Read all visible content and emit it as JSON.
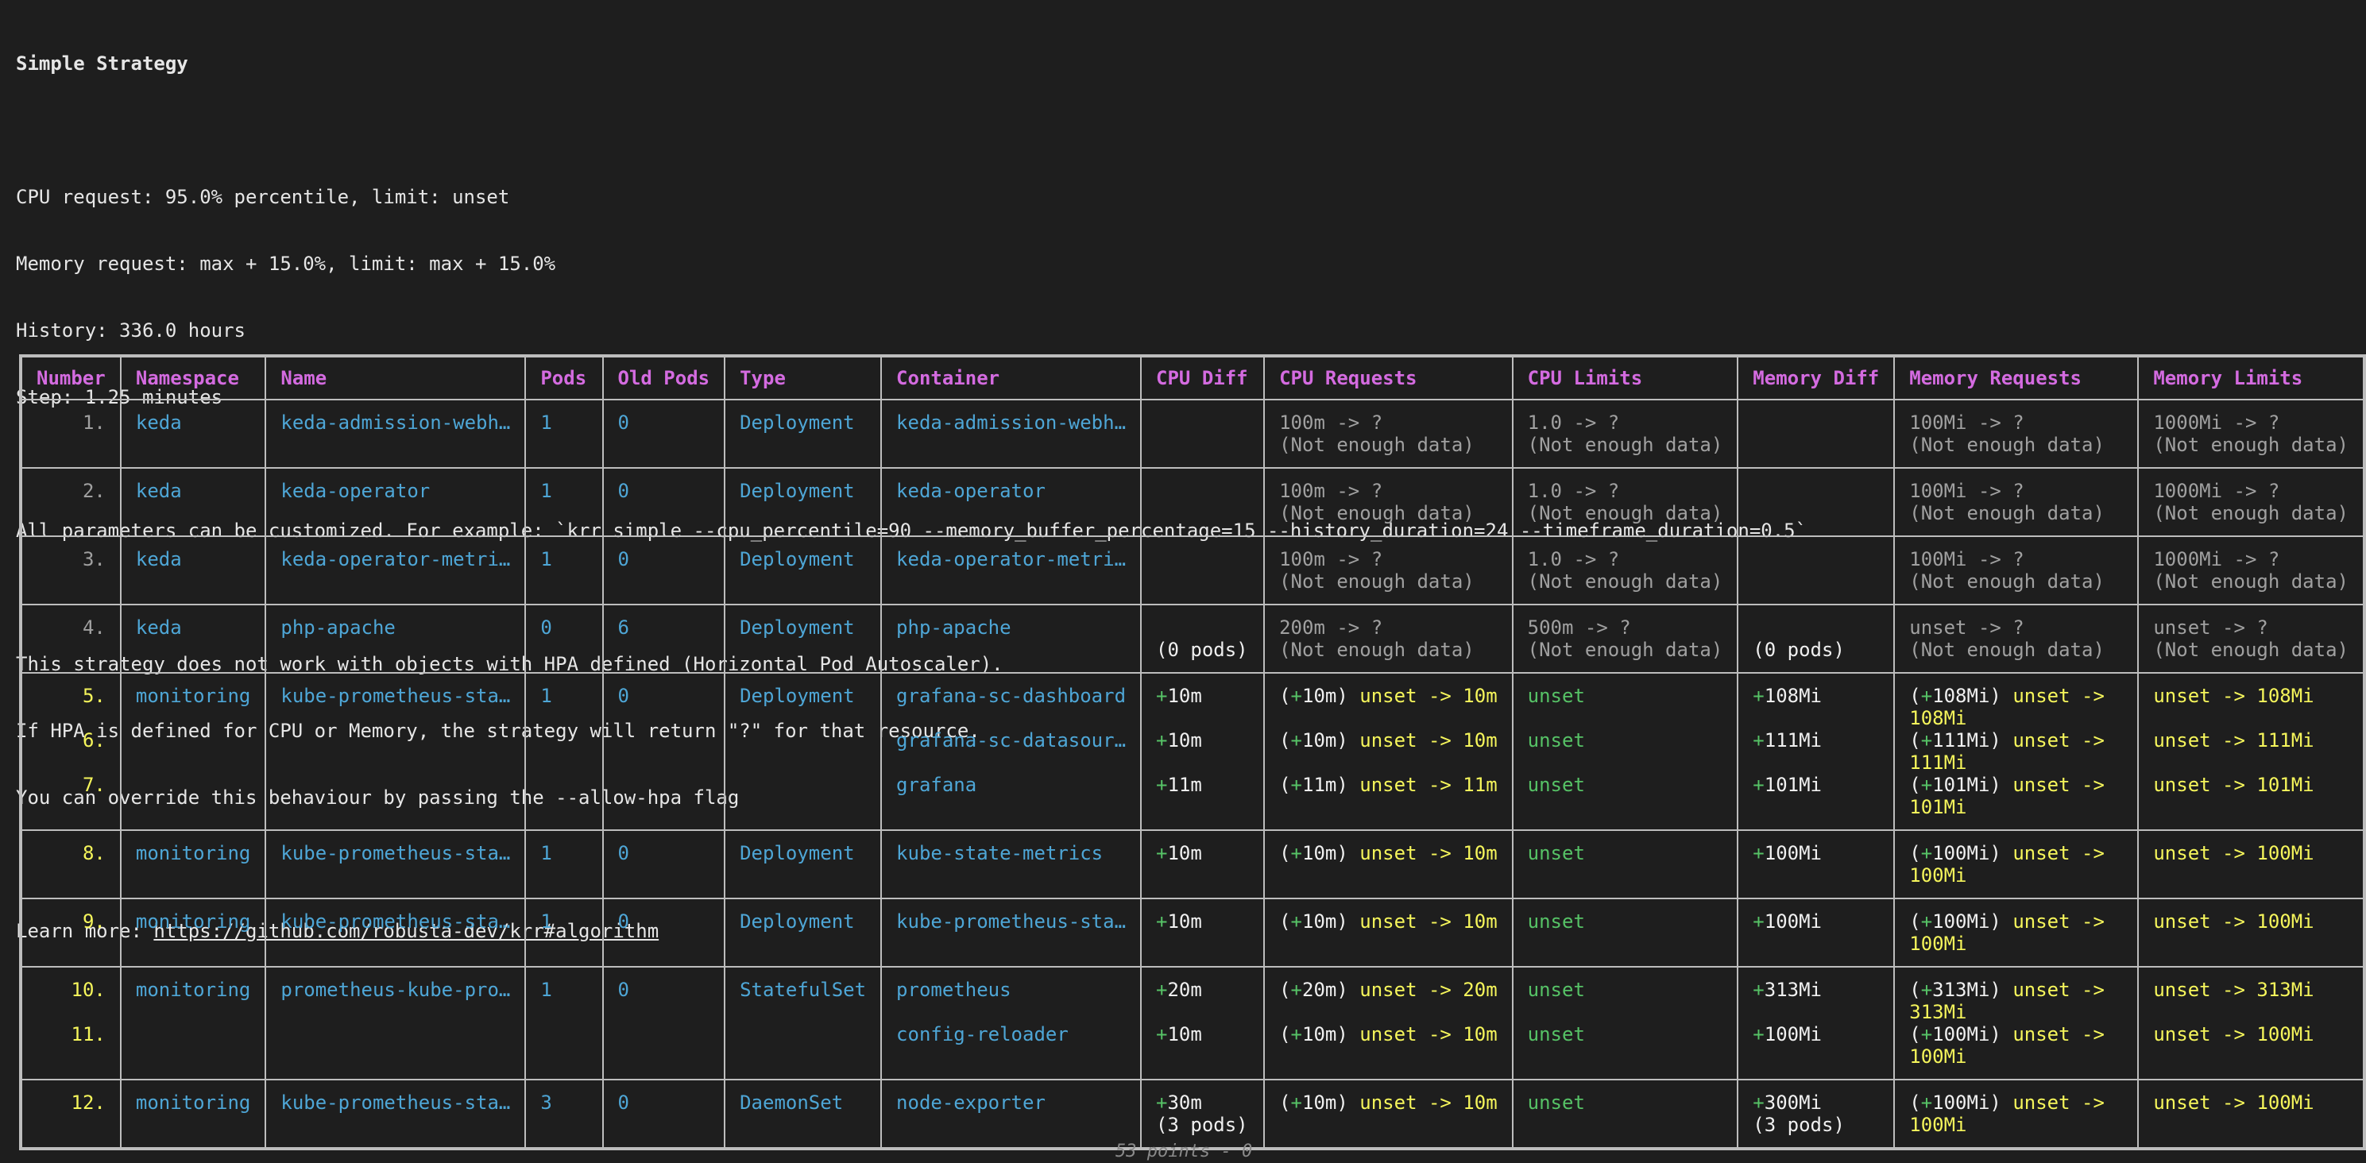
{
  "intro": {
    "title": "Simple Strategy",
    "lines1": [
      "CPU request: 95.0% percentile, limit: unset",
      "Memory request: max + 15.0%, limit: max + 15.0%",
      "History: 336.0 hours",
      "Step: 1.25 minutes"
    ],
    "customize": "All parameters can be customized. For example: `krr simple --cpu_percentile=90 --memory_buffer_percentage=15 --history_duration=24 --timeframe_duration=0.5`",
    "hpa_lines": [
      "This strategy does not work with objects with HPA defined (Horizontal Pod Autoscaler).",
      "If HPA is defined for CPU or Memory, the strategy will return \"?\" for that resource.",
      "You can override this behaviour by passing the --allow-hpa flag"
    ],
    "learn_more_label": "Learn more: ",
    "learn_more_url": "https://github.com/robusta-dev/krr#algorithm"
  },
  "table": {
    "headers": [
      "Number",
      "Namespace",
      "Name",
      "Pods",
      "Old Pods",
      "Type",
      "Container",
      "CPU Diff",
      "CPU Requests",
      "CPU Limits",
      "Memory Diff",
      "Memory Requests",
      "Memory Limits"
    ],
    "rows": [
      {
        "number": [
          "1."
        ],
        "namespace": "keda",
        "name": "keda-admission-webh…",
        "pods": "1",
        "old_pods": "0",
        "type": "Deployment",
        "containers": [
          "keda-admission-webh…"
        ],
        "cpu_diff": [
          ""
        ],
        "cpu_req": [
          "100m -> ?",
          "(Not enough data)"
        ],
        "cpu_lim": [
          "1.0 -> ?",
          "(Not enough data)"
        ],
        "mem_diff": [
          ""
        ],
        "mem_req": [
          "100Mi -> ?",
          "(Not enough data)"
        ],
        "mem_lim": [
          "1000Mi -> ?",
          "(Not enough data)"
        ]
      },
      {
        "number": [
          "2."
        ],
        "namespace": "keda",
        "name": "keda-operator",
        "pods": "1",
        "old_pods": "0",
        "type": "Deployment",
        "containers": [
          "keda-operator"
        ],
        "cpu_diff": [
          ""
        ],
        "cpu_req": [
          "100m -> ?",
          "(Not enough data)"
        ],
        "cpu_lim": [
          "1.0 -> ?",
          "(Not enough data)"
        ],
        "mem_diff": [
          ""
        ],
        "mem_req": [
          "100Mi -> ?",
          "(Not enough data)"
        ],
        "mem_lim": [
          "1000Mi -> ?",
          "(Not enough data)"
        ]
      },
      {
        "number": [
          "3."
        ],
        "namespace": "keda",
        "name": "keda-operator-metri…",
        "pods": "1",
        "old_pods": "0",
        "type": "Deployment",
        "containers": [
          "keda-operator-metri…"
        ],
        "cpu_diff": [
          ""
        ],
        "cpu_req": [
          "100m -> ?",
          "(Not enough data)"
        ],
        "cpu_lim": [
          "1.0 -> ?",
          "(Not enough data)"
        ],
        "mem_diff": [
          ""
        ],
        "mem_req": [
          "100Mi -> ?",
          "(Not enough data)"
        ],
        "mem_lim": [
          "1000Mi -> ?",
          "(Not enough data)"
        ]
      },
      {
        "number": [
          "4."
        ],
        "namespace": "keda",
        "name": "php-apache",
        "pods": "0",
        "old_pods": "6",
        "type": "Deployment",
        "containers": [
          "php-apache"
        ],
        "cpu_diff": [
          "(0 pods)"
        ],
        "cpu_req": [
          "200m -> ?",
          "(Not enough data)"
        ],
        "cpu_lim": [
          "500m -> ?",
          "(Not enough data)"
        ],
        "mem_diff": [
          "(0 pods)"
        ],
        "mem_req": [
          "unset -> ?",
          "(Not enough data)"
        ],
        "mem_lim": [
          "unset -> ?",
          "(Not enough data)"
        ]
      }
    ],
    "multi": [
      {
        "numbers": [
          "5.",
          "6.",
          "7."
        ],
        "namespace": "monitoring",
        "name": "kube-prometheus-sta…",
        "pods": "1",
        "old_pods": "0",
        "type": "Deployment",
        "containers": [
          "grafana-sc-dashboard",
          "grafana-sc-datasour…",
          "grafana"
        ],
        "cpu_diff": [
          "10m",
          "10m",
          "11m"
        ],
        "cpu_req": [
          [
            "10m",
            "unset -> 10m"
          ],
          [
            "10m",
            "unset -> 10m"
          ],
          [
            "11m",
            "unset -> 11m"
          ]
        ],
        "cpu_lim": [
          "unset",
          "unset",
          "unset"
        ],
        "mem_diff": [
          "108Mi",
          "111Mi",
          "101Mi"
        ],
        "mem_req": [
          [
            "108Mi",
            "unset ->",
            "108Mi"
          ],
          [
            "111Mi",
            "unset ->",
            "111Mi"
          ],
          [
            "101Mi",
            "unset ->",
            "101Mi"
          ]
        ],
        "mem_lim": [
          "unset -> 108Mi",
          "unset -> 111Mi",
          "unset -> 101Mi"
        ]
      },
      {
        "numbers": [
          "8."
        ],
        "namespace": "monitoring",
        "name": "kube-prometheus-sta…",
        "pods": "1",
        "old_pods": "0",
        "type": "Deployment",
        "containers": [
          "kube-state-metrics"
        ],
        "cpu_diff": [
          "10m"
        ],
        "cpu_req": [
          [
            "10m",
            "unset -> 10m"
          ]
        ],
        "cpu_lim": [
          "unset"
        ],
        "mem_diff": [
          "100Mi"
        ],
        "mem_req": [
          [
            "100Mi",
            "unset ->",
            "100Mi"
          ]
        ],
        "mem_lim": [
          "unset -> 100Mi"
        ]
      },
      {
        "numbers": [
          "9."
        ],
        "namespace": "monitoring",
        "name": "kube-prometheus-sta…",
        "pods": "1",
        "old_pods": "0",
        "type": "Deployment",
        "containers": [
          "kube-prometheus-sta…"
        ],
        "cpu_diff": [
          "10m"
        ],
        "cpu_req": [
          [
            "10m",
            "unset -> 10m"
          ]
        ],
        "cpu_lim": [
          "unset"
        ],
        "mem_diff": [
          "100Mi"
        ],
        "mem_req": [
          [
            "100Mi",
            "unset ->",
            "100Mi"
          ]
        ],
        "mem_lim": [
          "unset -> 100Mi"
        ]
      },
      {
        "numbers": [
          "10.",
          "11."
        ],
        "namespace": "monitoring",
        "name": "prometheus-kube-pro…",
        "pods": "1",
        "old_pods": "0",
        "type": "StatefulSet",
        "containers": [
          "prometheus",
          "config-reloader"
        ],
        "cpu_diff": [
          "20m",
          "10m"
        ],
        "cpu_req": [
          [
            "20m",
            "unset -> 20m"
          ],
          [
            "10m",
            "unset -> 10m"
          ]
        ],
        "cpu_lim": [
          "unset",
          "unset"
        ],
        "mem_diff": [
          "313Mi",
          "100Mi"
        ],
        "mem_req": [
          [
            "313Mi",
            "unset ->",
            "313Mi"
          ],
          [
            "100Mi",
            "unset ->",
            "100Mi"
          ]
        ],
        "mem_lim": [
          "unset -> 313Mi",
          "unset -> 100Mi"
        ]
      },
      {
        "numbers": [
          "12."
        ],
        "namespace": "monitoring",
        "name": "kube-prometheus-sta…",
        "pods": "3",
        "old_pods": "0",
        "type": "DaemonSet",
        "containers": [
          "node-exporter"
        ],
        "cpu_diff": [
          "30m"
        ],
        "cpu_diff_note": "(3 pods)",
        "cpu_req": [
          [
            "10m",
            "unset -> 10m"
          ]
        ],
        "cpu_lim": [
          "unset"
        ],
        "mem_diff": [
          "300Mi"
        ],
        "mem_diff_note": "(3 pods)",
        "mem_req": [
          [
            "100Mi",
            "unset ->",
            "100Mi"
          ]
        ],
        "mem_lim": [
          "unset -> 100Mi"
        ]
      }
    ]
  },
  "footer": "53 points - 0"
}
